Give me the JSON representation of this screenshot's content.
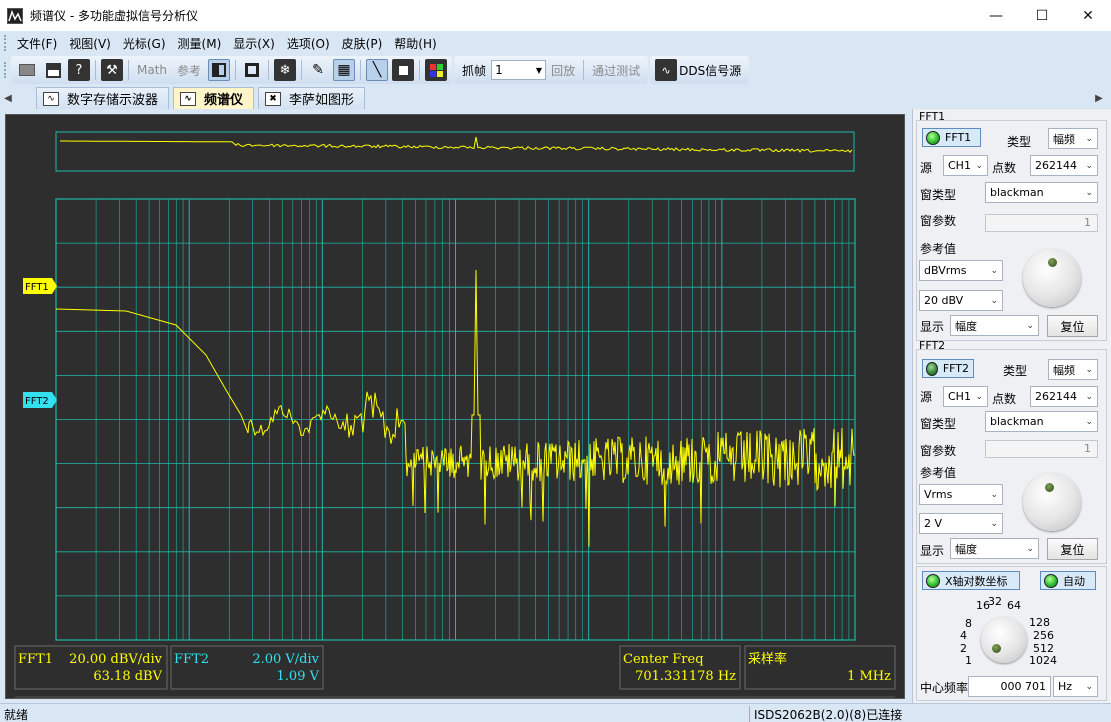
{
  "window": {
    "title": "频谱仪 - 多功能虚拟信号分析仪",
    "minimize_icon": "minimize-icon",
    "maximize_icon": "maximize-icon",
    "close_icon": "close-icon"
  },
  "menu": [
    "文件(F)",
    "视图(V)",
    "光标(G)",
    "测量(M)",
    "显示(X)",
    "选项(O)",
    "皮肤(P)",
    "帮助(H)"
  ],
  "toolbar": {
    "math_label": "Math",
    "ref_label": "参考",
    "capture_label": "抓帧",
    "capture_value": "1",
    "playback_label": "回放",
    "passtest_label": "通过测试",
    "dds_label": "DDS信号源"
  },
  "tabs": [
    "数字存储示波器",
    "频谱仪",
    "李萨如图形"
  ],
  "plot": {
    "marker_fft1": "FFT1",
    "marker_fft2": "FFT2",
    "fft1_label": "FFT1",
    "fft1_scale": "20.00 dBV/div",
    "fft1_value": "63.18 dBV",
    "fft2_label": "FFT2",
    "fft2_scale": "2.00 V/div",
    "fft2_value": "1.09 V",
    "center_freq_label": "Center Freq",
    "center_freq_value": "701.331178 Hz",
    "sample_rate_label": "采样率",
    "sample_rate_value": "1 MHz",
    "colors": {
      "fft1": "#ffff00",
      "fft2": "#33e0f0",
      "grid": "#1fb8a8",
      "bg": "#2e2e2e"
    }
  },
  "fft1": {
    "section": "FFT1",
    "toggle": "FFT1",
    "type_label": "类型",
    "type_value": "幅频",
    "source_label": "源",
    "source_value": "CH1",
    "points_label": "点数",
    "points_value": "262144",
    "window_label": "窗类型",
    "window_value": "blackman",
    "param_label": "窗参数",
    "param_value": "1",
    "ref_label": "参考值",
    "ref_unit": "dBVrms",
    "ref_value": "20 dBV",
    "display_label": "显示",
    "display_value": "幅度",
    "reset_label": "复位"
  },
  "fft2": {
    "section": "FFT2",
    "toggle": "FFT2",
    "type_label": "类型",
    "type_value": "幅频",
    "source_label": "源",
    "source_value": "CH1",
    "points_label": "点数",
    "points_value": "262144",
    "window_label": "窗类型",
    "window_value": "blackman",
    "param_label": "窗参数",
    "param_value": "1",
    "ref_label": "参考值",
    "ref_unit": "Vrms",
    "ref_value": "2 V",
    "display_label": "显示",
    "display_value": "幅度",
    "reset_label": "复位"
  },
  "xaxis": {
    "log_toggle": "X轴对数坐标",
    "auto_toggle": "自动",
    "scale": [
      "1",
      "2",
      "4",
      "8",
      "16",
      "32",
      "64",
      "128",
      "256",
      "512",
      "1024"
    ],
    "center_label": "中心频率",
    "center_value": "000 701",
    "center_unit": "Hz"
  },
  "status": {
    "left": "就绪",
    "right": "ISDS2062B(2.0)(8)已连接"
  }
}
